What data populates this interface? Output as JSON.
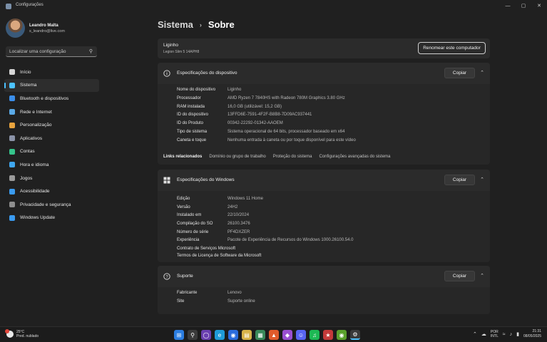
{
  "window": {
    "title": "Configurações",
    "controls": [
      "—",
      "▢",
      "✕"
    ]
  },
  "profile": {
    "name": "Leandro Malta",
    "email": "s_leandro@live.com"
  },
  "search": {
    "placeholder": "Localizar uma configuração"
  },
  "nav": [
    {
      "label": "Início",
      "icon": "home-icon",
      "color": "#d6d6d6"
    },
    {
      "label": "Sistema",
      "icon": "monitor-icon",
      "color": "#4cc2ff",
      "active": true
    },
    {
      "label": "Bluetooth e dispositivos",
      "icon": "bluetooth-icon",
      "color": "#3b8eea"
    },
    {
      "label": "Rede e Internet",
      "icon": "wifi-icon",
      "color": "#5aa9e6"
    },
    {
      "label": "Personalização",
      "icon": "brush-icon",
      "color": "#e8a33d"
    },
    {
      "label": "Aplicativos",
      "icon": "apps-icon",
      "color": "#8b93a8"
    },
    {
      "label": "Contas",
      "icon": "person-icon",
      "color": "#35c48b"
    },
    {
      "label": "Hora e idioma",
      "icon": "globe-icon",
      "color": "#3fa7f0"
    },
    {
      "label": "Jogos",
      "icon": "gamepad-icon",
      "color": "#9a9a9a"
    },
    {
      "label": "Acessibilidade",
      "icon": "accessibility-icon",
      "color": "#3a9bf0"
    },
    {
      "label": "Privacidade e segurança",
      "icon": "shield-icon",
      "color": "#8d8d8d"
    },
    {
      "label": "Windows Update",
      "icon": "update-icon",
      "color": "#3a9bf0"
    }
  ],
  "breadcrumb": {
    "parent": "Sistema",
    "separator": "›",
    "current": "Sobre"
  },
  "device": {
    "name": "Liginho",
    "model": "Legion Slim 5 14APH8",
    "rename_label": "Renomear este computador"
  },
  "device_specs": {
    "title": "Especificações do dispositivo",
    "copy_label": "Copiar",
    "rows": [
      {
        "k": "Nome do dispositivo",
        "v": "Liginho"
      },
      {
        "k": "Processador",
        "v": "AMD Ryzen 7 7840HS with Radeon 780M Graphics    3.80 GHz"
      },
      {
        "k": "RAM instalada",
        "v": "16,0 GB (utilizável: 15,2 GB)"
      },
      {
        "k": "ID do dispositivo",
        "v": "13FFD6E-7591-4F2F-B8B8-7D09AC937441"
      },
      {
        "k": "ID do Produto",
        "v": "00342-22292-01342-AAOEM"
      },
      {
        "k": "Tipo de sistema",
        "v": "Sistema operacional de 64 bits, processador baseado em x64"
      },
      {
        "k": "Caneta e toque",
        "v": "Nenhuma entrada à caneta ou por toque disponível para este vídeo"
      }
    ],
    "related_title": "Links relacionados",
    "related_links": [
      "Domínio ou grupo de trabalho",
      "Proteção do sistema",
      "Configurações avançadas do sistema"
    ]
  },
  "windows_specs": {
    "title": "Especificações do Windows",
    "copy_label": "Copiar",
    "rows": [
      {
        "k": "Edição",
        "v": "Windows 11 Home"
      },
      {
        "k": "Versão",
        "v": "24H2"
      },
      {
        "k": "Instalado em",
        "v": "22/10/2024"
      },
      {
        "k": "Compilação do SO",
        "v": "26100.3476"
      },
      {
        "k": "Número de série",
        "v": "PF4DXZER"
      },
      {
        "k": "Experiência",
        "v": "Pacote de Experiência de Recursos do Windows 1000.26100.54.0"
      }
    ],
    "links": [
      "Contrato de Serviços Microsoft",
      "Termos de Licença de Software da Microsoft"
    ]
  },
  "support": {
    "title": "Suporte",
    "copy_label": "Copiar",
    "rows": [
      {
        "k": "Fabricante",
        "v": "Lenovo"
      },
      {
        "k": "Site",
        "v": "Suporte online"
      }
    ]
  },
  "taskbar": {
    "weather_temp": "25°C",
    "weather_desc": "Pred. nublado",
    "lang_line1": "POR",
    "lang_line2": "INTL",
    "time": "21:31",
    "date": "08/05/2025"
  },
  "colors": {
    "accent": "#4cc2ff",
    "bg": "#202020",
    "card": "#2b2b2b"
  }
}
